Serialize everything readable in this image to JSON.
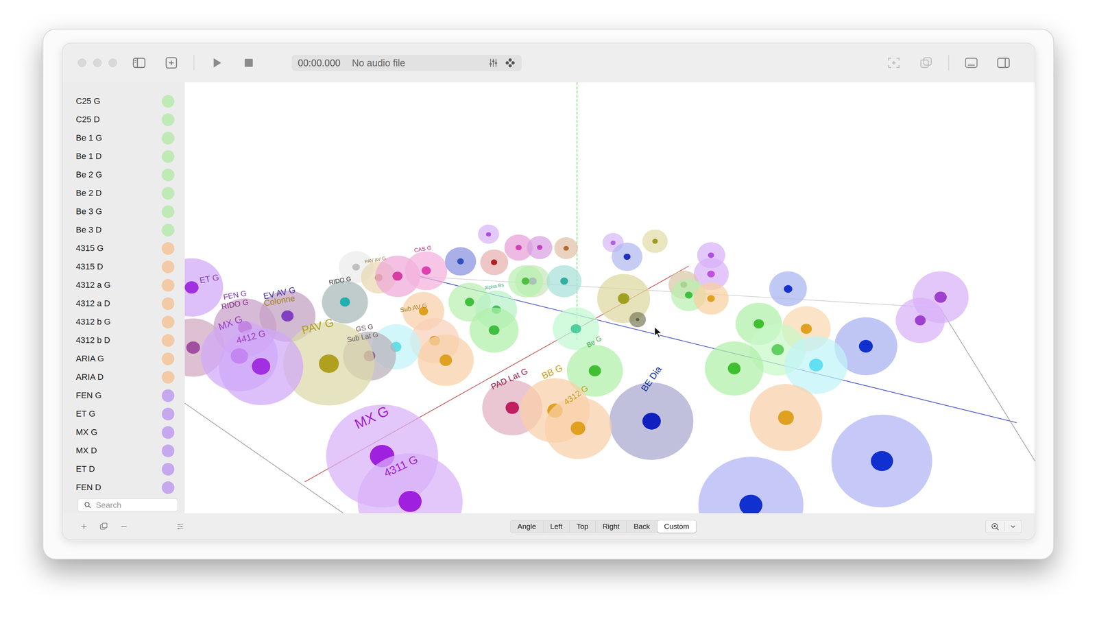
{
  "toolbar": {
    "time": "00:00.000",
    "audio": "No audio file"
  },
  "sidebar": {
    "items": [
      {
        "name": "C25 G",
        "color": "#bfeab5"
      },
      {
        "name": "C25 D",
        "color": "#bfeab5"
      },
      {
        "name": "Be 1 G",
        "color": "#bfeab5"
      },
      {
        "name": "Be 1 D",
        "color": "#bfeab5"
      },
      {
        "name": "Be 2 G",
        "color": "#bfeab5"
      },
      {
        "name": "Be 2 D",
        "color": "#bfeab5"
      },
      {
        "name": "Be 3 G",
        "color": "#bfeab5"
      },
      {
        "name": "Be 3 D",
        "color": "#bfeab5"
      },
      {
        "name": "4315 G",
        "color": "#f2caa5"
      },
      {
        "name": "4315 D",
        "color": "#f2caa5"
      },
      {
        "name": "4312 a G",
        "color": "#f2caa5"
      },
      {
        "name": "4312 a D",
        "color": "#f2caa5"
      },
      {
        "name": "4312 b G",
        "color": "#f2caa5"
      },
      {
        "name": "4312 b D",
        "color": "#f2caa5"
      },
      {
        "name": "ARIA G",
        "color": "#f2caa5"
      },
      {
        "name": "ARIA D",
        "color": "#f2caa5"
      },
      {
        "name": "FEN G",
        "color": "#c6a8ee"
      },
      {
        "name": "ET G",
        "color": "#c6a8ee"
      },
      {
        "name": "MX G",
        "color": "#c6a8ee"
      },
      {
        "name": "MX D",
        "color": "#c6a8ee"
      },
      {
        "name": "ET D",
        "color": "#c6a8ee"
      },
      {
        "name": "FEN D",
        "color": "#c6a8ee"
      }
    ],
    "search": {
      "placeholder": "Search"
    }
  },
  "views": [
    {
      "label": "Angle",
      "selected": false
    },
    {
      "label": "Left",
      "selected": false
    },
    {
      "label": "Top",
      "selected": false
    },
    {
      "label": "Right",
      "selected": false
    },
    {
      "label": "Back",
      "selected": false
    },
    {
      "label": "Custom",
      "selected": true
    }
  ],
  "viewport": {
    "spheres": [
      {
        "color": "#d8b4f8",
        "core": "#b04ee0"
      },
      {
        "color": "#e8a0d8",
        "core": "#d040b0"
      },
      {
        "color": "#d8a0e0",
        "core": "#c040c0"
      },
      {
        "color": "#e0c0a8",
        "core": "#b06a30"
      },
      {
        "color": "#d8b8f8",
        "core": "#b060e0"
      },
      {
        "color": "#e0dca8",
        "core": "#a09a20"
      },
      {
        "color": "#d8b0f8",
        "core": "#b050e0"
      },
      {
        "color": "#ececec",
        "core": "#c0c0c0"
      },
      {
        "color": "#e8d8b0",
        "core": "#c09040"
      },
      {
        "color": "#f0a8d8",
        "core": "#d83aa8"
      },
      {
        "color": "#f4b0dc",
        "core": "#e040b0"
      },
      {
        "color": "#8890e0",
        "core": "#3050c0"
      },
      {
        "color": "#e8b0b0",
        "core": "#b02020"
      },
      {
        "color": "#c8e8b8",
        "core": "#8050c0"
      },
      {
        "color": "#a8e0d8",
        "core": "#30b0a0"
      },
      {
        "color": "#b0b8f0",
        "core": "#2030c0"
      },
      {
        "color": "#d8b0f8",
        "core": "#c050e0"
      },
      {
        "color": "#a8b4f0",
        "core": "#1830d0"
      },
      {
        "color": "#d8c8a8",
        "core": "#908040"
      },
      {
        "color": "#b8f0b0",
        "core": "#40c040"
      },
      {
        "color": "#f8d0a0",
        "core": "#e0a020"
      },
      {
        "color": "#dcd8a0",
        "core": "#a0a020"
      },
      {
        "color": "#808060",
        "core": "#606040"
      },
      {
        "color": "#b8f0b0",
        "core": "#50c040"
      },
      {
        "color": "#a8b8b8",
        "core": "#20b0b0"
      },
      {
        "color": "#d0a8f8",
        "core": "#a030e0"
      },
      {
        "color": "#b8f0b0",
        "core": "#40c040"
      },
      {
        "color": "#b8f0c8",
        "core": "#40c060"
      },
      {
        "color": "#f8d0a8",
        "core": "#e0a020"
      },
      {
        "color": "#c0f8d0",
        "core": "#50d0a0"
      },
      {
        "color": "#b0f0a8",
        "core": "#40c030"
      },
      {
        "color": "#f8d8b0",
        "core": "#e0a020"
      },
      {
        "color": "#d8b0f8",
        "core": "#a040d0"
      },
      {
        "color": "#d8b0f8",
        "core": "#a040d0"
      },
      {
        "color": "#c0a0c0",
        "core": "#8040c0"
      },
      {
        "color": "#b0f0a8",
        "core": "#40c040"
      },
      {
        "color": "#c8a0c8",
        "core": "#a030a0"
      },
      {
        "color": "#f8d0b8",
        "core": "#e0a030"
      },
      {
        "color": "#a8b0f0",
        "core": "#1030d0"
      },
      {
        "color": "#d0a8c0",
        "core": "#a050a0"
      },
      {
        "color": "#c0f4f8",
        "core": "#60e0e8"
      },
      {
        "color": "#b8b0b8",
        "core": "#906090"
      },
      {
        "color": "#c8f8c8",
        "core": "#60d060"
      },
      {
        "color": "#d0a8f8",
        "core": "#a030e0"
      },
      {
        "color": "#f8d0a8",
        "core": "#e0a020"
      },
      {
        "color": "#dcd8a8",
        "core": "#b0a020"
      },
      {
        "color": "#d0a8f8",
        "core": "#a030e0"
      },
      {
        "color": "#c0f4f8",
        "core": "#60e0f0"
      },
      {
        "color": "#b0f0a8",
        "core": "#40c030"
      },
      {
        "color": "#b0f0a8",
        "core": "#40c030"
      },
      {
        "color": "#e0b0c0",
        "core": "#c02060"
      },
      {
        "color": "#f8d0a8",
        "core": "#e0a020"
      },
      {
        "color": "#f8d0a8",
        "core": "#e0a020"
      },
      {
        "color": "#a8a8d0",
        "core": "#1020c0"
      },
      {
        "color": "#f8d0a8",
        "core": "#e0a020"
      },
      {
        "color": "#b0b4f4",
        "core": "#1030d0"
      },
      {
        "color": "#d8b0f8",
        "core": "#a020e0"
      },
      {
        "color": "#d8b0f8",
        "core": "#a020e0"
      },
      {
        "color": "#b0b4f4",
        "core": "#1030d0"
      }
    ],
    "labels": [
      {
        "text": "ET G",
        "color": "#8040c0"
      },
      {
        "text": "FEN G",
        "color": "#8040c0"
      },
      {
        "text": "RIDO G",
        "color": "#803080"
      },
      {
        "text": "EV AV G",
        "color": "#4030a0"
      },
      {
        "text": "Colonne",
        "color": "#a08020"
      },
      {
        "text": "MX G",
        "color": "#a040c0"
      },
      {
        "text": "4412 G",
        "color": "#a040c0"
      },
      {
        "text": "PAV G",
        "color": "#b0a020"
      },
      {
        "text": "GS G",
        "color": "#706060"
      },
      {
        "text": "Sub Lat G",
        "color": "#606060"
      },
      {
        "text": "Sub AV G",
        "color": "#b08020"
      },
      {
        "text": "RIDO G",
        "color": "#303030"
      },
      {
        "text": "CAS G",
        "color": "#c03080"
      },
      {
        "text": "PAV AV G",
        "color": "#a08040"
      },
      {
        "text": "Alpha Bs",
        "color": "#40b080"
      },
      {
        "text": "PAD Lat G",
        "color": "#a02050"
      },
      {
        "text": "BB G",
        "color": "#d0a020"
      },
      {
        "text": "4312 G",
        "color": "#d0a020"
      },
      {
        "text": "BE Dia",
        "color": "#1030a0"
      },
      {
        "text": "Be G",
        "color": "#40b040"
      },
      {
        "text": "MX G",
        "color": "#a020d0"
      },
      {
        "text": "4311 G",
        "color": "#a020d0"
      }
    ]
  }
}
